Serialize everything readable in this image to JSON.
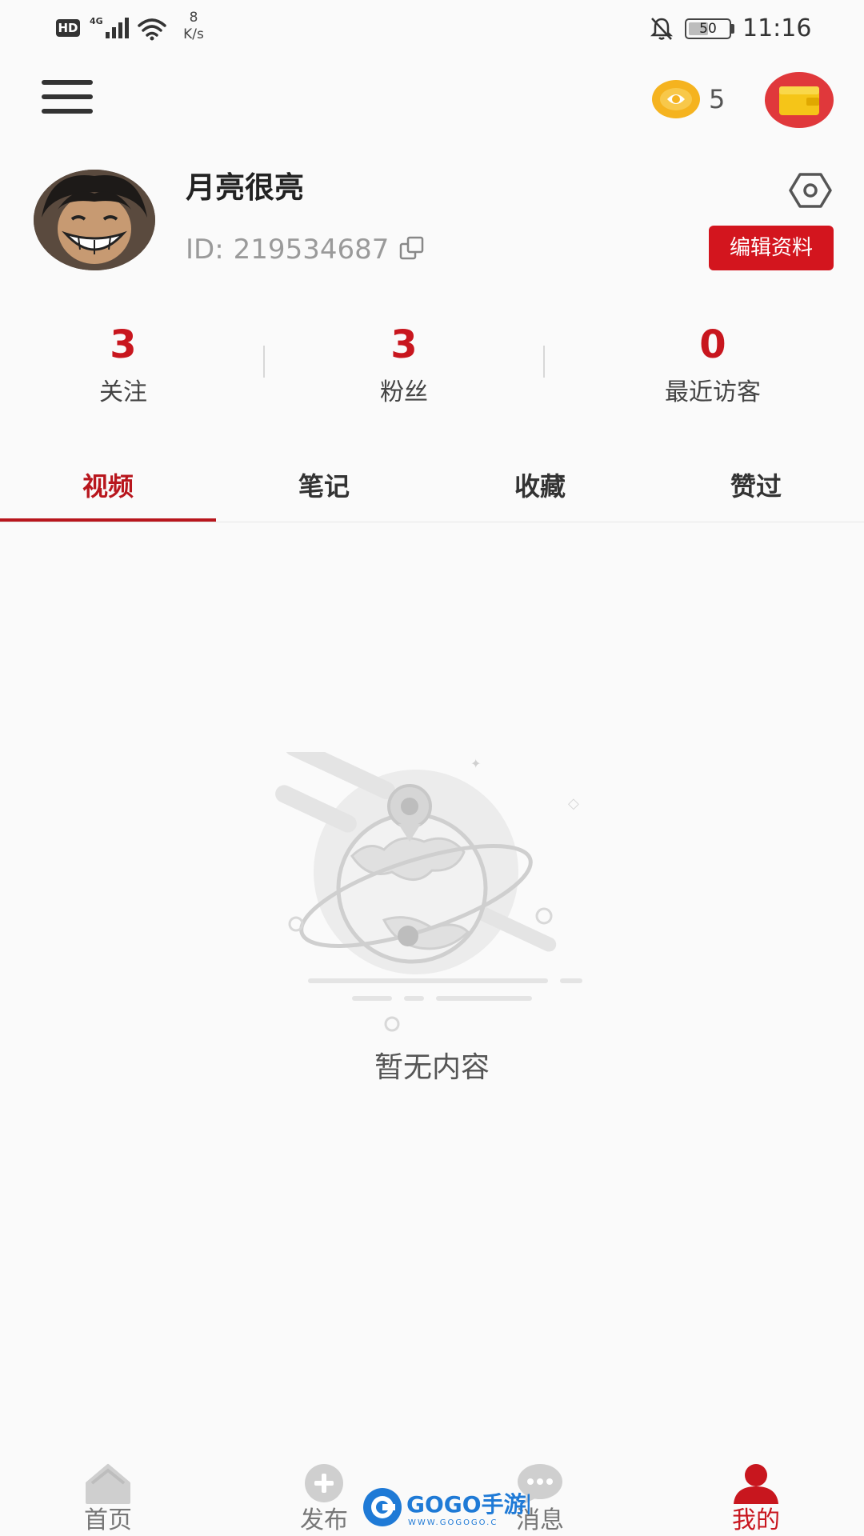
{
  "status_bar": {
    "hd": "HD",
    "network": "4G",
    "speed_value": "8",
    "speed_unit": "K/s",
    "battery": "50",
    "time": "11:16"
  },
  "header": {
    "coin_count": "5"
  },
  "profile": {
    "username": "月亮很亮",
    "id_label": "ID:",
    "id_value": "219534687",
    "edit_label": "编辑资料"
  },
  "stats": [
    {
      "value": "3",
      "label": "关注"
    },
    {
      "value": "3",
      "label": "粉丝"
    },
    {
      "value": "0",
      "label": "最近访客"
    }
  ],
  "tabs": [
    {
      "label": "视频",
      "active": true
    },
    {
      "label": "笔记",
      "active": false
    },
    {
      "label": "收藏",
      "active": false
    },
    {
      "label": "赞过",
      "active": false
    }
  ],
  "empty_state": {
    "text": "暂无内容"
  },
  "bottom_nav": [
    {
      "label": "首页",
      "icon": "home-icon",
      "active": false
    },
    {
      "label": "发布",
      "icon": "plus-icon",
      "active": false
    },
    {
      "label": "消息",
      "icon": "chat-icon",
      "active": false
    },
    {
      "label": "我的",
      "icon": "person-icon",
      "active": true
    }
  ],
  "watermark": {
    "brand": "GOGO手游网",
    "url": "WWW.GOGOGO.C"
  },
  "colors": {
    "accent": "#c8161e",
    "edit_button": "#d3151e",
    "coin": "#f5b31f",
    "wallet_bg": "#e0383b"
  }
}
